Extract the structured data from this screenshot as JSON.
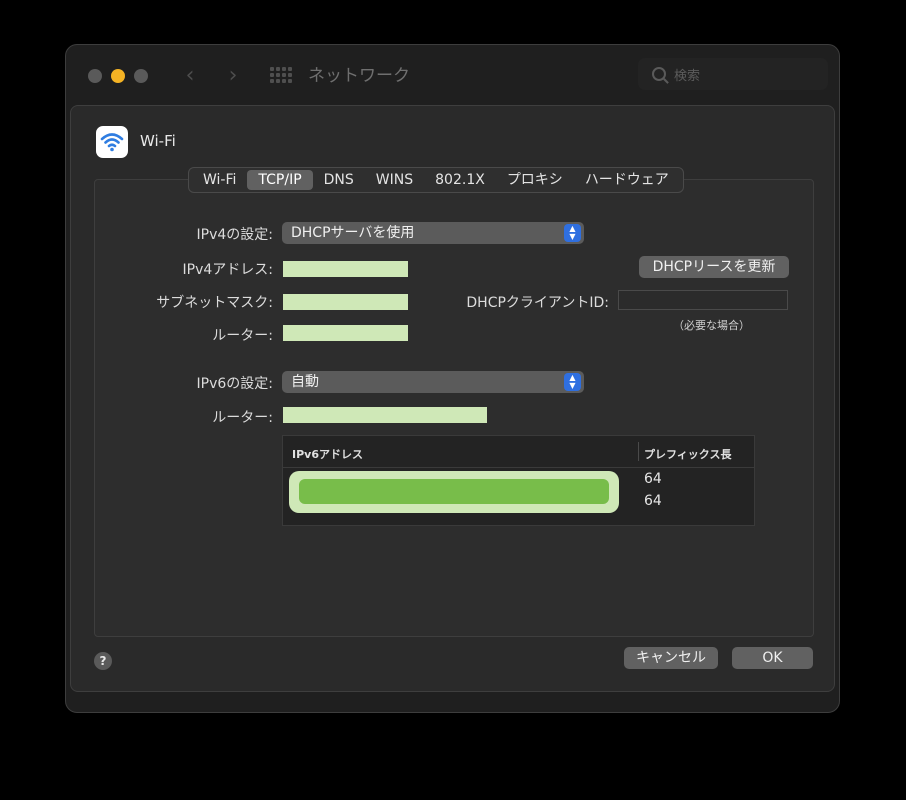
{
  "window": {
    "title": "ネットワーク",
    "search_placeholder": "検索"
  },
  "sheet": {
    "interface_name": "Wi-Fi"
  },
  "tabs": [
    "Wi-Fi",
    "TCP/IP",
    "DNS",
    "WINS",
    "802.1X",
    "プロキシ",
    "ハードウェア"
  ],
  "active_tab": "TCP/IP",
  "ipv4": {
    "config_label": "IPv4の設定:",
    "config_value": "DHCPサーバを使用",
    "address_label": "IPv4アドレス:",
    "subnet_label": "サブネットマスク:",
    "router_label": "ルーター:",
    "renew_button": "DHCPリースを更新",
    "client_id_label": "DHCPクライアントID:",
    "client_id_hint": "（必要な場合）"
  },
  "ipv6": {
    "config_label": "IPv6の設定:",
    "config_value": "自動",
    "router_label": "ルーター:",
    "table": {
      "col_address": "IPv6アドレス",
      "col_prefix": "プレフィックス長",
      "rows": [
        {
          "prefix": "64"
        },
        {
          "prefix": "64"
        }
      ]
    }
  },
  "footer": {
    "help": "?",
    "cancel": "キャンセル",
    "ok": "OK"
  },
  "colors": {
    "accent": "#2f6fe0",
    "redaction_light": "#cfe8b7",
    "redaction_green": "#78bd4a",
    "traffic_minimize": "#f5b324"
  },
  "icons": [
    "close-icon",
    "minimize-icon",
    "zoom-icon",
    "chevron-left-icon",
    "chevron-right-icon",
    "grid-icon",
    "search-icon",
    "wifi-icon",
    "stepper-icon",
    "help-icon"
  ]
}
